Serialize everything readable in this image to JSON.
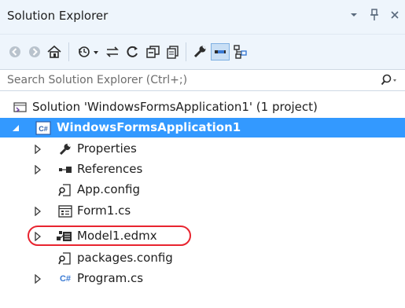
{
  "panel": {
    "title": "Solution Explorer"
  },
  "title_controls": [
    "dropdown-arrow",
    "pin",
    "close"
  ],
  "toolbar": {
    "buttons": [
      "back",
      "forward",
      "home",
      "history-dropdown",
      "sync",
      "refresh",
      "collapse-all",
      "show-all-files",
      "properties",
      "preview",
      "view-class-diagram"
    ]
  },
  "search": {
    "placeholder": "Search Solution Explorer (Ctrl+;)"
  },
  "tree": {
    "solution": "Solution 'WindowsFormsApplication1' (1 project)",
    "project": "WindowsFormsApplication1",
    "project_icon_text": "C#",
    "items": [
      {
        "label": "Properties"
      },
      {
        "label": "References"
      },
      {
        "label": "App.config"
      },
      {
        "label": "Form1.cs"
      },
      {
        "label": "Model1.edmx"
      },
      {
        "label": "packages.config"
      },
      {
        "label": "Program.cs",
        "icon_text": "C#"
      }
    ]
  },
  "colors": {
    "panel_bg": "#eef5fc",
    "selection": "#3399ff",
    "highlight_ring": "#e8242f",
    "accent_blue": "#3b7bd4"
  }
}
